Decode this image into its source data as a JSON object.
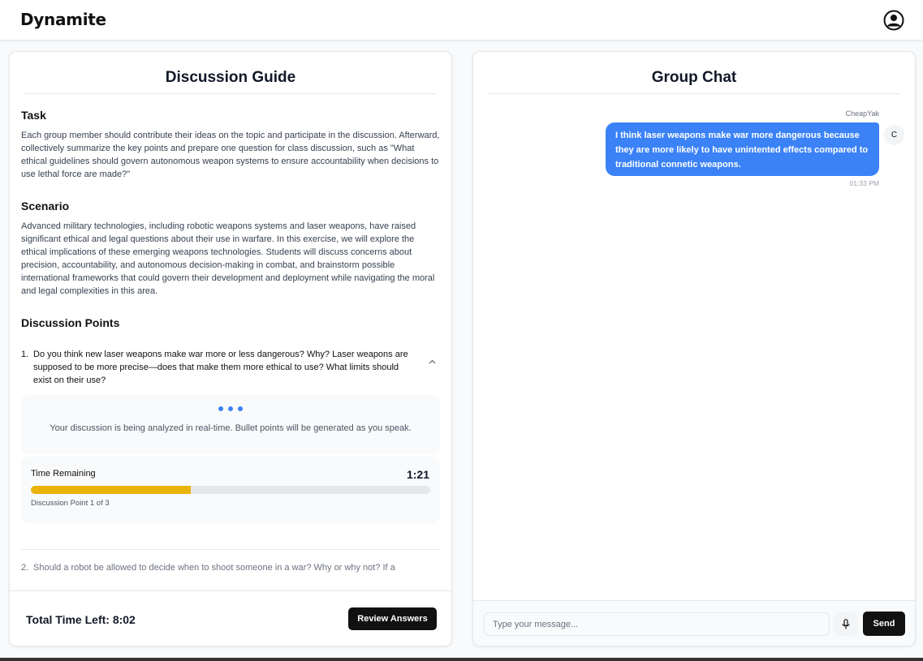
{
  "app": {
    "brand": "Dynamite",
    "profile_icon": "user-circle-icon"
  },
  "guide": {
    "title": "Discussion Guide",
    "task_heading": "Task",
    "task_text": "Each group member should contribute their ideas on the topic and participate in the discussion. Afterward, collectively summarize the key points and prepare one question for class discussion, such as \"What ethical guidelines should govern autonomous weapon systems to ensure accountability when decisions to use lethal force are made?\"",
    "scenario_heading": "Scenario",
    "scenario_text": "Advanced military technologies, including robotic weapons systems and laser weapons, have raised significant ethical and legal questions about their use in warfare. In this exercise, we will explore the ethical implications of these emerging weapons technologies. Students will discuss concerns about precision, accountability, and autonomous decision-making in combat, and brainstorm possible international frameworks that could govern their development and deployment while navigating the moral and legal complexities in this area.",
    "points_heading": "Discussion Points",
    "points": [
      {
        "num": "1.",
        "text": "Do you think new laser weapons make war more or less dangerous? Why? Laser weapons are supposed to be more precise—does that make them more ethical to use? What limits should exist on their use?"
      },
      {
        "num": "2.",
        "text": "Should a robot be allowed to decide when to shoot someone in a war? Why or why not? If a"
      }
    ],
    "analysis_text": "Your discussion is being analyzed in real-time. Bullet points will be generated as you speak.",
    "timer": {
      "label": "Time Remaining",
      "value": "1:21",
      "progress_percent": 40,
      "progress_color": "#eab308",
      "sub": "Discussion Point 1 of 3"
    },
    "total_time": "Total Time Left: 8:02",
    "review_button": "Review Answers"
  },
  "chat": {
    "title": "Group Chat",
    "messages": [
      {
        "sender": "CheapYak",
        "avatar_initial": "C",
        "text": "I think laser weapons make war more dangerous because they are more likely to have unintented effects compared to traditional connetic weapons.",
        "time": "01:33 PM",
        "bubble_color": "#3b82f6"
      }
    ],
    "input_placeholder": "Type your message...",
    "mic_icon": "microphone-icon",
    "send_button": "Send"
  }
}
